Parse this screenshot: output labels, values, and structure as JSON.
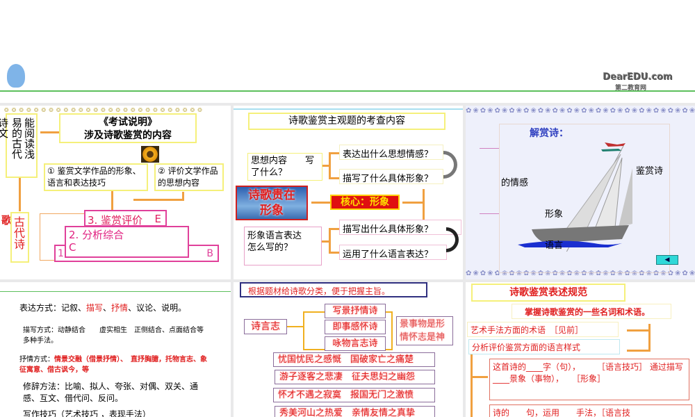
{
  "banner": {
    "logo": "DearEDU.com",
    "logo_sub": "第二教育网"
  },
  "slide1": {
    "left_col1": "诗文",
    "left_col2": "易的古代",
    "left_col3": "能阅读浅",
    "title1": "《考试说明》",
    "title2": "涉及诗歌鉴赏的内容",
    "box1": "① 鉴赏文学作品的形象、语言和表达技巧",
    "box2": "② 评价文学作品的思想内容",
    "side_char": "歌",
    "ancient": "古代诗",
    "level3": "3. 鉴赏评价",
    "level3_tag": "E",
    "level2": "2. 分析综合",
    "level2_tag": "C",
    "level1": "1",
    "level1_tag": "B"
  },
  "slide2": {
    "title": "诗歌鉴赏主观题的考查内容",
    "content_box": "思想内容　　写了什么？",
    "q1": "表达出什么思想情感？",
    "q2": "描写了什么具体形象？",
    "banner": "诗歌贵在形象",
    "core": "核心：形象",
    "lang_box": "形象语言表达　　　怎么写的？",
    "q3": "描写出什么具体形象？",
    "q4": "运用了什么语言表达？"
  },
  "slide3": {
    "heading": "解赏诗：",
    "l1": "的情感",
    "l2": "鉴赏诗",
    "l3": "形象",
    "l4": "语言"
  },
  "slide4": {
    "line1_a": "表达方式：记叙、",
    "line1_b": "描写",
    "line1_c": "、",
    "line1_d": "抒情",
    "line1_e": "、议论、说明。",
    "line2": "描写方式：动静结合　　虚实相生　正侧结合、点面结合等多种手法。",
    "line3_label": "抒情方式：",
    "line3": "情景交融（借景抒情）、　直抒胸臆，托物言志、象征寓意、借古讽今，等",
    "line4": "修辞方法：比喻、拟人、夸张、对偶、双关、通感、互文、借代问、反问。",
    "line5": "写作技巧（艺术技巧 ，表现手法）"
  },
  "slide5": {
    "header": "根据题材给诗歌分类，便于把握主旨。",
    "root": "诗言志",
    "types": [
      "写景抒情诗",
      "即事感怀诗",
      "咏物言志诗"
    ],
    "note": "景事物是形情怀志是神",
    "themes": [
      "忧国忧民之感慨　国破家亡之痛楚",
      "游子逐客之悲凄　征夫思妇之幽怨",
      "怀才不遇之寂寞　报国无门之激愤",
      "秀美河山之热爱　亲情友情之真挚"
    ]
  },
  "slide6": {
    "title": "诗歌鉴赏表述规范",
    "sub": "掌握诗歌鉴赏的一些名词和术语。",
    "item1": "艺术手法方面的术语　［见前］",
    "item2": "分析评价鉴赏方面的语言样式",
    "box1": "这首诗的____字（句），　　　［语言技巧］ 通过描写____景象（事物），　　［形象］",
    "box2": "诗的____句，运用____手法，［语言技"
  }
}
